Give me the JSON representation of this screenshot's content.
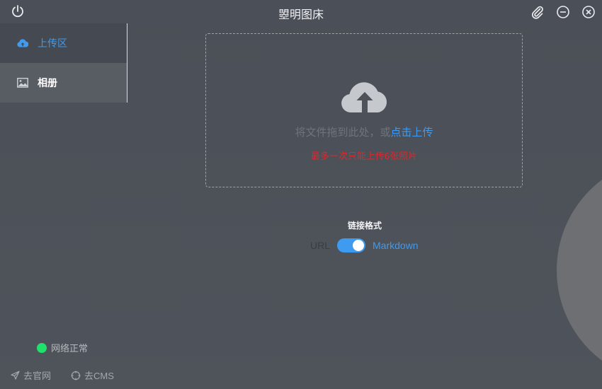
{
  "window": {
    "title": "曌明图床"
  },
  "sidebar": {
    "items": [
      {
        "label": "上传区",
        "icon": "cloud-upload-icon"
      },
      {
        "label": "相册",
        "icon": "image-icon"
      }
    ]
  },
  "upload": {
    "drop_text": "将文件拖到此处，或",
    "click_text": "点击上传",
    "limit_text": "最多一次只能上传6张照片"
  },
  "link_format": {
    "label": "链接格式",
    "left_option": "URL",
    "right_option": "Markdown",
    "selected": "Markdown"
  },
  "status": {
    "text": "网络正常",
    "color": "#1fe26d"
  },
  "footer": {
    "official_site": "去官网",
    "cms": "去CMS"
  },
  "colors": {
    "accent": "#3e9bf0",
    "warning": "#e1262c",
    "background": "#4b4f57"
  }
}
